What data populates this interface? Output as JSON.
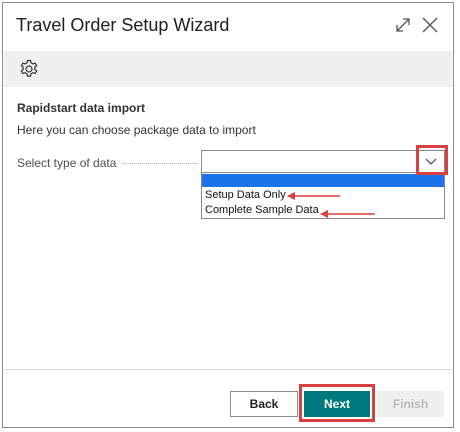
{
  "dialog": {
    "title": "Travel Order Setup Wizard"
  },
  "content": {
    "section_title": "Rapidstart data import",
    "instruction": "Here you can choose package data to import",
    "field_label": "Select type of data",
    "selected_value": ""
  },
  "dropdown": {
    "options": [
      {
        "label": ""
      },
      {
        "label": "Setup Data Only"
      },
      {
        "label": "Complete Sample Data"
      }
    ]
  },
  "footer": {
    "back_label": "Back",
    "next_label": "Next",
    "finish_label": "Finish"
  },
  "icons": {
    "expand": "expand-icon",
    "close": "close-icon",
    "settings": "gear-icon",
    "dropdown": "chevron-down-icon"
  },
  "colors": {
    "accent": "#00797c",
    "highlight": "#1a73e8",
    "annotation": "#d9413f"
  }
}
